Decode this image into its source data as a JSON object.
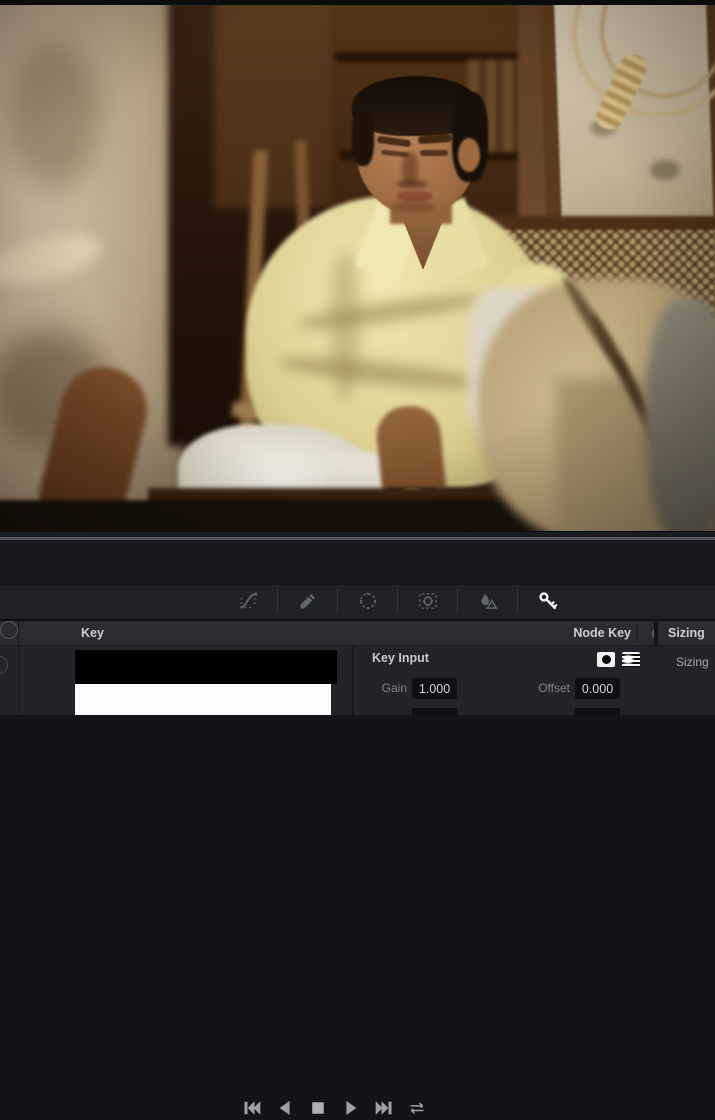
{
  "viewer": {
    "description": "Film still: heavyset man with slicked-back dark hair and pale yellow shirt seated on a cane chair in a rustic room; white plaster wall and dark doorway at left, pin board and hanging rope on brown wall at right, blurred khaki trouser leg in the foreground"
  },
  "transport": {
    "buttons": [
      {
        "icon": "skip-first-icon"
      },
      {
        "icon": "play-reverse-icon"
      },
      {
        "icon": "stop-icon"
      },
      {
        "icon": "play-icon"
      },
      {
        "icon": "skip-last-icon"
      },
      {
        "icon": "loop-icon"
      }
    ]
  },
  "toolbar": {
    "tools": [
      {
        "icon": "curves-icon",
        "active": false
      },
      {
        "icon": "qualifier-icon",
        "active": false
      },
      {
        "icon": "power-window-icon",
        "active": false
      },
      {
        "icon": "tracker-icon",
        "active": false
      },
      {
        "icon": "blur-icon",
        "active": false
      },
      {
        "icon": "key-icon",
        "active": true
      }
    ]
  },
  "panels": {
    "key": {
      "title": "Key",
      "node_key_label": "Node Key",
      "reset_icon": "reset-icon",
      "key_input": {
        "title": "Key Input",
        "matte_icons": [
          "matte-solid-icon",
          "matte-stripes-icon"
        ],
        "fields": [
          {
            "label": "Gain",
            "value": "1.000"
          },
          {
            "label": "Offset",
            "value": "0.000"
          }
        ]
      }
    },
    "sizing": {
      "title": "Sizing",
      "label": "Sizing"
    }
  },
  "colors": {
    "active_icon": "#ededef",
    "muted_icon": "#62646c",
    "panel_header_bg": "#2b2c32",
    "panel_bg": "#232429",
    "toolbar_bg": "#202127",
    "transport_bg": "#17181c",
    "value_box_bg": "#0f1013",
    "shirt_yellow": "#ddd193"
  }
}
